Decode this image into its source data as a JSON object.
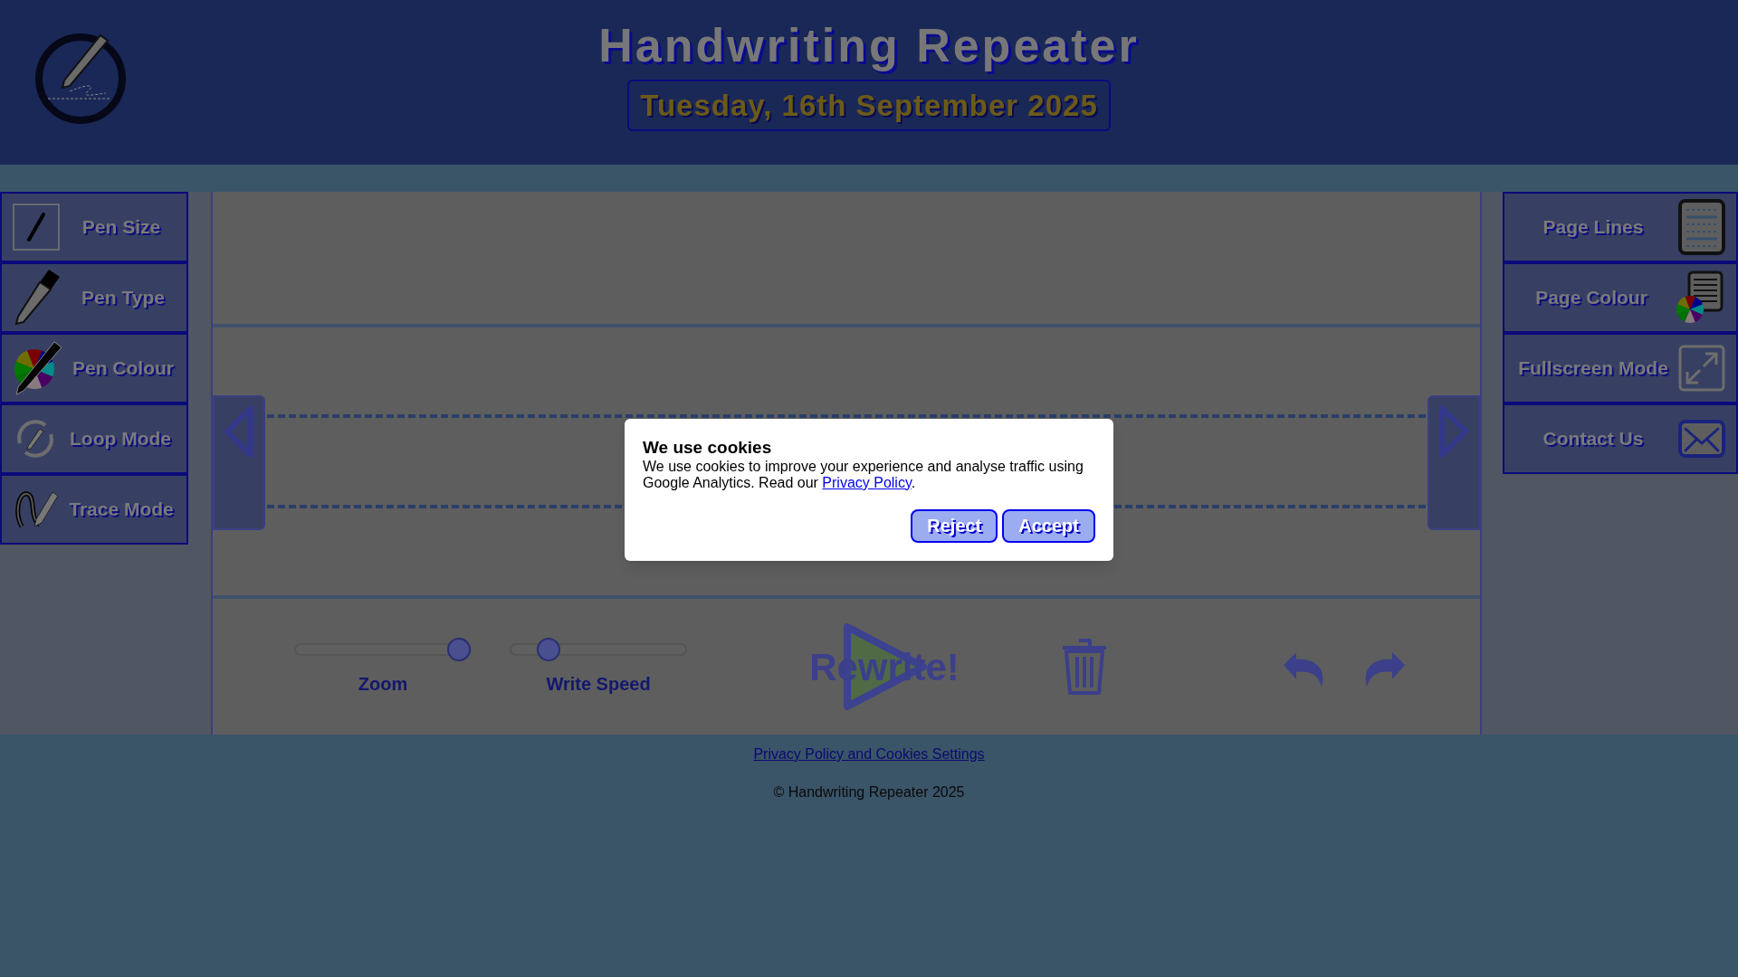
{
  "header": {
    "title": "Handwriting Repeater",
    "date": "Tuesday, 16th September 2025"
  },
  "left_menu": [
    {
      "kind": "pen-size",
      "label": "Pen Size"
    },
    {
      "kind": "pen-type",
      "label": "Pen Type"
    },
    {
      "kind": "pen-colour",
      "label": "Pen Colour"
    },
    {
      "kind": "loop",
      "label": "Loop Mode"
    },
    {
      "kind": "trace",
      "label": "Trace Mode"
    }
  ],
  "right_menu": [
    {
      "kind": "page-lines",
      "label": "Page Lines"
    },
    {
      "kind": "page-colour",
      "label": "Page Colour"
    },
    {
      "kind": "fullscreen",
      "label": "Fullscreen Mode"
    },
    {
      "kind": "contact",
      "label": "Contact Us"
    }
  ],
  "controls": {
    "sliders": [
      {
        "label": "Zoom",
        "level": 0.93
      },
      {
        "label": "Write Speed",
        "level": 0.22
      }
    ],
    "rewrite_button": "Rewrite!"
  },
  "footer": {
    "link": "Privacy Policy and Cookies Settings",
    "copyright": "© Handwriting Repeater 2025"
  },
  "cookie_dialog": {
    "title": "We use cookies",
    "text": "We use cookies to improve your experience and analyse traffic using Google Analytics. Read our ",
    "link": "Privacy Policy",
    "text_after": ".",
    "buttons": [
      "Reject",
      "Accept"
    ]
  }
}
